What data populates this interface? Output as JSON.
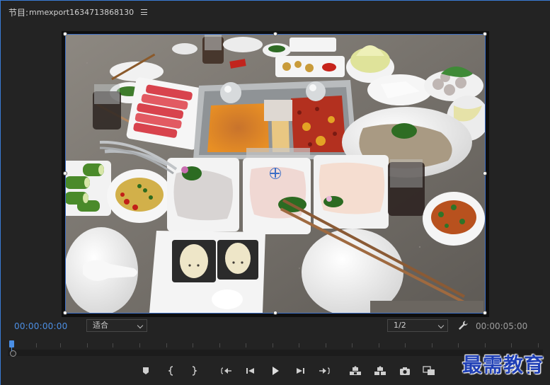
{
  "header": {
    "label": "节目:",
    "sequence_name": "mmexport1634713868130"
  },
  "controls": {
    "timecode_current": "00:00:00:00",
    "zoom_label": "适合",
    "resolution_label": "1/2",
    "timecode_duration": "00:00:05:00"
  },
  "toolbar": {
    "buttons": [
      "marker-icon",
      "mark-in-icon",
      "mark-out-icon",
      "go-to-in-icon",
      "step-back-icon",
      "play-icon",
      "step-forward-icon",
      "go-to-out-icon",
      "lift-icon",
      "extract-icon",
      "export-frame-icon",
      "comparison-view-icon"
    ]
  },
  "watermark": "最需教育",
  "colors": {
    "accent": "#4d8fe3",
    "panel_bg": "#232323",
    "selection": "#3d6fc6"
  }
}
